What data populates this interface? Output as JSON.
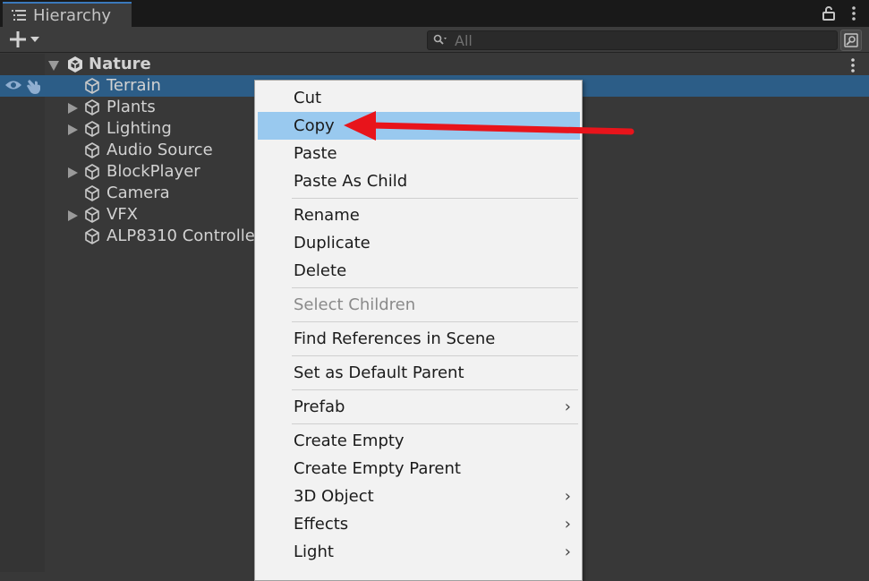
{
  "tab": {
    "title": "Hierarchy",
    "icon": "list-icon"
  },
  "tab_tools": {
    "lock_icon": "lock-icon",
    "menu_icon": "kebab-icon"
  },
  "toolbar": {
    "add_icon": "plus-icon",
    "search_placeholder": "All"
  },
  "tree": {
    "scene": {
      "label": "Nature"
    },
    "items": [
      {
        "label": "Terrain",
        "selected": true,
        "foldout": false
      },
      {
        "label": "Plants",
        "foldout": true
      },
      {
        "label": "Lighting",
        "foldout": true
      },
      {
        "label": "Audio Source",
        "foldout": false
      },
      {
        "label": "BlockPlayer",
        "foldout": true
      },
      {
        "label": "Camera",
        "foldout": false
      },
      {
        "label": "VFX",
        "foldout": true
      },
      {
        "label": "ALP8310 Controlle",
        "foldout": false
      }
    ]
  },
  "menu": {
    "items": [
      {
        "label": "Cut"
      },
      {
        "label": "Copy",
        "highlighted": true
      },
      {
        "label": "Paste"
      },
      {
        "label": "Paste As Child"
      },
      {
        "label": "Rename"
      },
      {
        "label": "Duplicate"
      },
      {
        "label": "Delete"
      },
      {
        "label": "Select Children",
        "disabled": true
      },
      {
        "label": "Find References in Scene"
      },
      {
        "label": "Set as Default Parent"
      },
      {
        "label": "Prefab",
        "submenu": true
      },
      {
        "label": "Create Empty"
      },
      {
        "label": "Create Empty Parent"
      },
      {
        "label": "3D Object",
        "submenu": true
      },
      {
        "label": "Effects",
        "submenu": true
      },
      {
        "label": "Light",
        "submenu": true
      }
    ],
    "submenu_glyph": "›"
  },
  "colors": {
    "selection": "#2c5d87",
    "menu_highlight": "#99c9ef",
    "annotation_arrow": "#e8141b"
  }
}
